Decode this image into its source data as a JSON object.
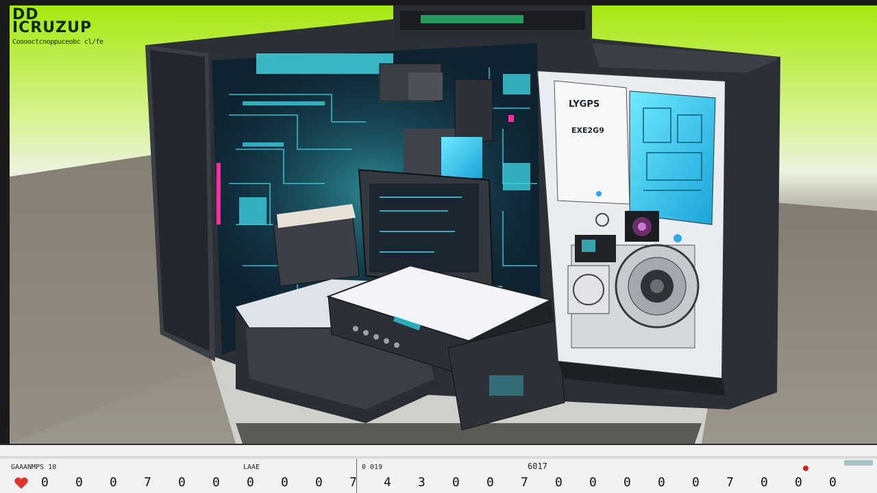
{
  "brand": {
    "line1": "DD",
    "line2": "ICRUZUP",
    "subtitle": "Cooooctcnoppuceobc cl/fe"
  },
  "case_labels": {
    "top": "LYGPS",
    "bottom": "EXE2G9"
  },
  "timeline": {
    "left_label": "GAAANMPS  10",
    "mid_label": "LAAE",
    "time_label": "0 019",
    "frame_label": "6017",
    "ticks": [
      "0",
      "0",
      "0",
      "7",
      "0",
      "0",
      "0",
      "0",
      "0",
      "7",
      "4",
      "3",
      "0",
      "0",
      "7",
      "0",
      "0",
      "0",
      "0",
      "0",
      "7",
      "0",
      "0",
      "0"
    ]
  },
  "colors": {
    "background_green": "#a8e810",
    "case_dark": "#2b2f36",
    "glow_cyan": "#2fe3f5",
    "accent_magenta": "#ff2fa0",
    "playhead_red": "#d2201e"
  }
}
